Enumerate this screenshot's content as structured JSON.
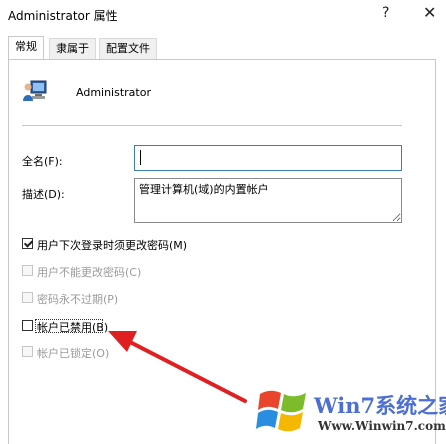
{
  "window": {
    "title": "Administrator 属性",
    "help_label": "?",
    "close_label": "✕"
  },
  "tabs": [
    {
      "label": "常规",
      "active": true
    },
    {
      "label": "隶属于",
      "active": false
    },
    {
      "label": "配置文件",
      "active": false
    }
  ],
  "general": {
    "username": "Administrator",
    "fullname_label": "全名(F):",
    "fullname_value": "",
    "description_label": "描述(D):",
    "description_value": "管理计算机(域)的内置帐户",
    "checkboxes": [
      {
        "label": "用户下次登录时须更改密码(M)",
        "checked": true,
        "enabled": true
      },
      {
        "label": "用户不能更改密码(C)",
        "checked": false,
        "enabled": false
      },
      {
        "label": "密码永不过期(P)",
        "checked": false,
        "enabled": false
      },
      {
        "label": "帐户已禁用(B)",
        "checked": false,
        "enabled": true
      },
      {
        "label": "帐户已锁定(O)",
        "checked": false,
        "enabled": false
      }
    ]
  },
  "watermark": {
    "brand": "Win7系统之家",
    "url": "Www.Winwin7.com"
  },
  "colors": {
    "annotation_arrow": "#e02020",
    "focus_border": "#3c7fb1",
    "watermark_brand": "#4c6fd1"
  }
}
